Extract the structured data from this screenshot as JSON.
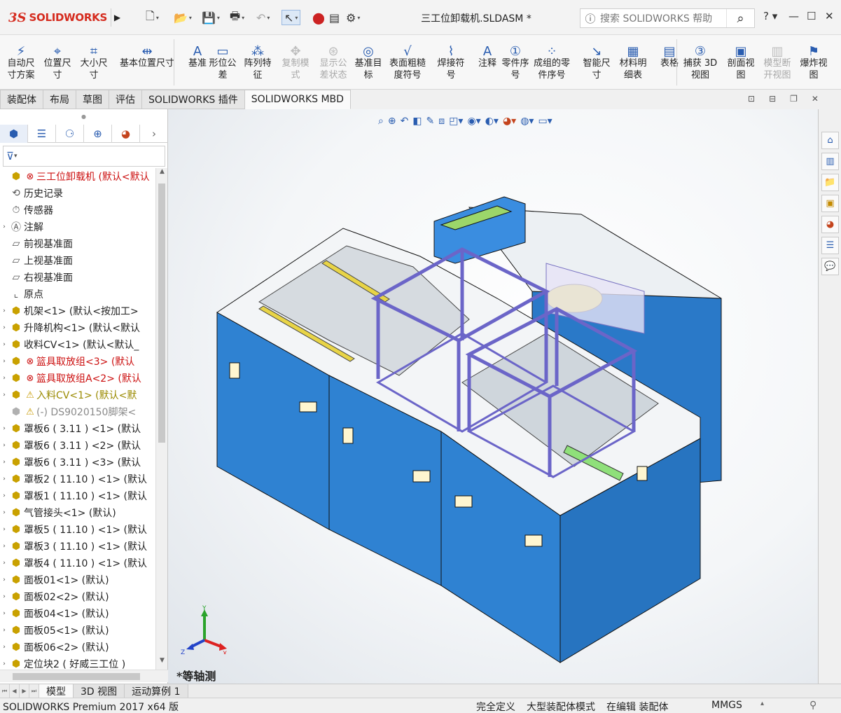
{
  "app": {
    "logo_mark": "3S",
    "logo_name": "SOLIDWORKS",
    "doc_title": "三工位卸载机.SLDASM *"
  },
  "search": {
    "placeholder": "搜索 SOLIDWORKS 帮助"
  },
  "toolbar": {
    "items": [
      {
        "label": "自动尺\n寸方案",
        "icon": "auto-dimension-icon",
        "enabled": true
      },
      {
        "label": "位置尺\n寸",
        "icon": "location-dimension-icon",
        "enabled": true
      },
      {
        "label": "大小尺\n寸",
        "icon": "size-dimension-icon",
        "enabled": true
      },
      {
        "label": "基本位置尺寸",
        "icon": "basic-location-dimension-icon",
        "enabled": true
      },
      {
        "label": "基准",
        "icon": "datum-icon",
        "enabled": true
      },
      {
        "label": "形位公\n差",
        "icon": "geometric-tolerance-icon",
        "enabled": true
      },
      {
        "label": "阵列特\n征",
        "icon": "pattern-feature-icon",
        "enabled": true
      },
      {
        "label": "复制模\n式",
        "icon": "copy-scheme-icon",
        "enabled": false
      },
      {
        "label": "显示公\n差状态",
        "icon": "show-tolerance-status-icon",
        "enabled": false
      },
      {
        "label": "基准目\n标",
        "icon": "datum-target-icon",
        "enabled": true
      },
      {
        "label": "表面粗糙\n度符号",
        "icon": "surface-finish-icon",
        "enabled": true
      },
      {
        "label": "焊接符\n号",
        "icon": "weld-symbol-icon",
        "enabled": true
      },
      {
        "label": "注释",
        "icon": "note-icon",
        "enabled": true
      },
      {
        "label": "零件序\n号",
        "icon": "balloon-icon",
        "enabled": true
      },
      {
        "label": "成组的零\n件序号",
        "icon": "stacked-balloon-icon",
        "enabled": true
      },
      {
        "label": "智能尺\n寸",
        "icon": "smart-dimension-icon",
        "enabled": true
      },
      {
        "label": "材料明\n细表",
        "icon": "bom-icon",
        "enabled": true
      },
      {
        "label": "表格",
        "icon": "table-icon",
        "enabled": true
      },
      {
        "label": "捕获 3D\n视图",
        "icon": "capture-3d-view-icon",
        "enabled": true
      },
      {
        "label": "剖面视\n图",
        "icon": "section-view-icon",
        "enabled": true
      },
      {
        "label": "模型断\n开视图",
        "icon": "model-break-view-icon",
        "enabled": false
      },
      {
        "label": "爆炸视\n图",
        "icon": "explode-view-icon",
        "enabled": true
      }
    ]
  },
  "tabs": [
    "装配体",
    "布局",
    "草图",
    "评估",
    "SOLIDWORKS 插件",
    "SOLIDWORKS MBD"
  ],
  "active_tab": "SOLIDWORKS MBD",
  "tree": [
    {
      "label": "三工位卸载机 (默认<默认",
      "marker": "error",
      "expand": false,
      "icon": "assembly-icon"
    },
    {
      "label": "历史记录",
      "expand": false,
      "icon": "history-icon"
    },
    {
      "label": "传感器",
      "expand": false,
      "icon": "sensor-icon"
    },
    {
      "label": "注解",
      "expand": true,
      "icon": "annotation-icon"
    },
    {
      "label": "前视基准面",
      "expand": false,
      "icon": "plane-icon"
    },
    {
      "label": "上视基准面",
      "expand": false,
      "icon": "plane-icon"
    },
    {
      "label": "右视基准面",
      "expand": false,
      "icon": "plane-icon"
    },
    {
      "label": "原点",
      "expand": false,
      "icon": "origin-icon"
    },
    {
      "label": "机架<1> (默认<按加工>",
      "expand": true,
      "icon": "subassembly-icon"
    },
    {
      "label": "升降机构<1> (默认<默认",
      "expand": true,
      "icon": "subassembly-icon"
    },
    {
      "label": "收料CV<1> (默认<默认_",
      "expand": true,
      "icon": "subassembly-icon"
    },
    {
      "label": "篮具取放组<3> (默认",
      "expand": true,
      "marker": "error",
      "icon": "subassembly-icon"
    },
    {
      "label": "篮具取放组A<2> (默认",
      "expand": true,
      "marker": "error",
      "icon": "subassembly-icon"
    },
    {
      "label": "入料CV<1> (默认<默",
      "expand": true,
      "marker": "warning",
      "icon": "subassembly-icon"
    },
    {
      "label": "(-) DS9020150脚架<",
      "expand": false,
      "marker": "warning",
      "icon": "part-icon",
      "suppressed": true
    },
    {
      "label": "罩板6 ( 3.11 ) <1> (默认",
      "expand": true,
      "icon": "part-icon"
    },
    {
      "label": "罩板6 ( 3.11 ) <2> (默认",
      "expand": true,
      "icon": "part-icon"
    },
    {
      "label": "罩板6 ( 3.11 ) <3> (默认",
      "expand": true,
      "icon": "part-icon"
    },
    {
      "label": "罩板2 ( 11.10 ) <1> (默认",
      "expand": true,
      "icon": "part-icon"
    },
    {
      "label": "罩板1 ( 11.10 ) <1> (默认",
      "expand": true,
      "icon": "part-icon"
    },
    {
      "label": "气管接头<1> (默认)",
      "expand": true,
      "icon": "part-icon"
    },
    {
      "label": "罩板5 ( 11.10 ) <1> (默认",
      "expand": true,
      "icon": "part-icon"
    },
    {
      "label": "罩板3 ( 11.10 ) <1> (默认",
      "expand": true,
      "icon": "part-icon"
    },
    {
      "label": "罩板4 ( 11.10 ) <1> (默认",
      "expand": true,
      "icon": "part-icon"
    },
    {
      "label": "面板01<1> (默认)",
      "expand": true,
      "icon": "part-icon"
    },
    {
      "label": "面板02<2> (默认)",
      "expand": true,
      "icon": "part-icon"
    },
    {
      "label": "面板04<1> (默认)",
      "expand": true,
      "icon": "part-icon"
    },
    {
      "label": "面板05<1> (默认)",
      "expand": true,
      "icon": "part-icon"
    },
    {
      "label": "面板06<2> (默认)",
      "expand": true,
      "icon": "part-icon"
    },
    {
      "label": "定位块2 ( 好威三工位 )",
      "expand": true,
      "icon": "part-icon"
    }
  ],
  "viewport": {
    "view_name": "*等轴测",
    "triad": {
      "x": "X",
      "y": "Y",
      "z": "Z"
    }
  },
  "bottom_tabs": [
    "模型",
    "3D 视图",
    "运动算例 1"
  ],
  "active_bottom_tab": "模型",
  "status": {
    "product": "SOLIDWORKS Premium 2017 x64 版",
    "definition": "完全定义",
    "mode": "大型装配体模式",
    "editing": "在编辑 装配体",
    "units": "MMGS"
  },
  "colors": {
    "brand": "#d52b1e",
    "frame_blue": "#2f82d2",
    "frame_purple": "#8a86d6",
    "error": "#cc1010",
    "warning": "#9a8a00"
  }
}
